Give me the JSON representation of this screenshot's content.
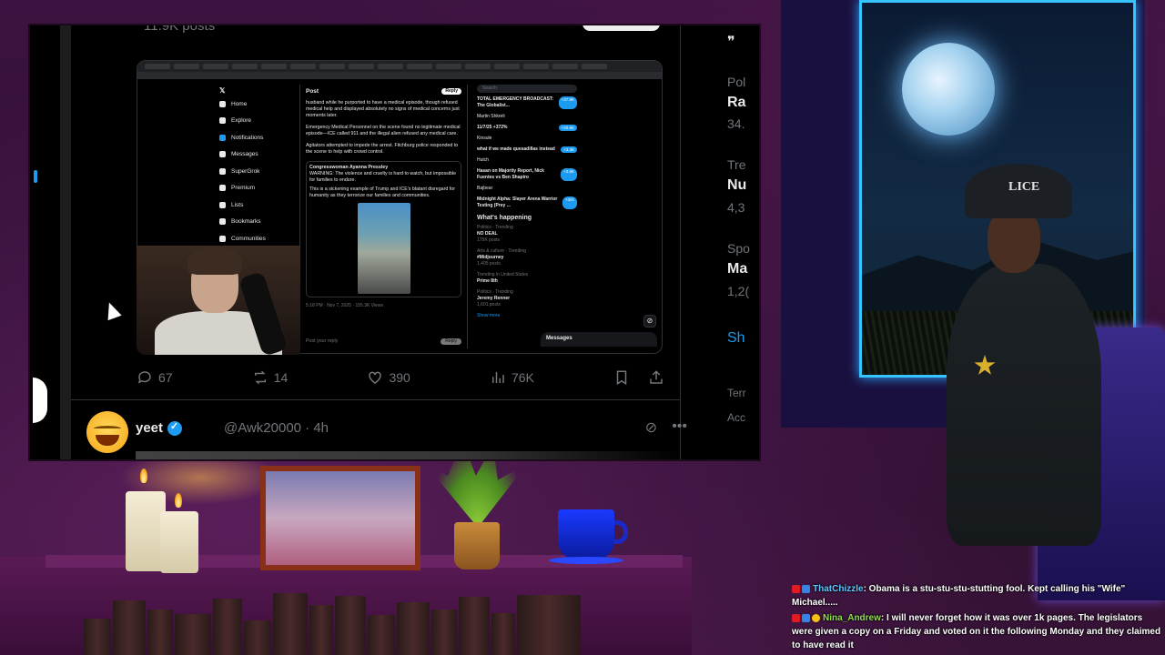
{
  "stream_window": {
    "posts_count": "11.9K posts",
    "tweet_actions": {
      "replies": "67",
      "reposts": "14",
      "likes": "390",
      "views": "76K"
    },
    "next_tweet": {
      "name": "yeet",
      "handle": "@Awk20000 · 4h"
    },
    "right_col": {
      "label1": "Pol",
      "bold1": "Ra",
      "num1": "34.",
      "label2": "Tre",
      "bold2": "Nu",
      "num2": "4,3",
      "label3": "Spo",
      "bold3": "Ma",
      "num3": "1,2(",
      "show_more": "Sh",
      "terms": "Terr",
      "acc": "Acc"
    }
  },
  "nested_screenshot": {
    "nav": [
      "Home",
      "Explore",
      "Notifications",
      "Messages",
      "SuperGrok",
      "Premium",
      "Lists",
      "Bookmarks",
      "Communities"
    ],
    "post_header": "Post",
    "reply_btn": "Reply",
    "paragraphs": [
      "husband while he purported to have a medical episode, though refused medical help and displayed absolutely no signs of medical concerns just moments later.",
      "Emergency Medical Personnel on the scene found no legitimate medical episode—ICE called 911 and the illegal alien refused any medical care.",
      "Agitators attempted to impede the arrest. Fitchburg police responded to the scene to help with crowd control."
    ],
    "quote_author": "Congresswoman Ayanna Pressley",
    "quote_text": "WARNING: The violence and cruelty is hard to watch, but impossible for families to endure.",
    "quote_text2": "This is a sickening example of Trump and ICE's blatant disregard for humanity as they terrorize our families and communities.",
    "meta": "5:18 PM · Nov 7, 2025 · 155.3K Views",
    "reply_placeholder": "Post your reply",
    "reply_send": "Reply",
    "search_placeholder": "Search",
    "side_items": [
      {
        "title": "TOTAL EMERGENCY BROADCAST: The Globalist...",
        "badge": "+37.9K"
      },
      {
        "title": "Martin Shkreli",
        "badge": ""
      },
      {
        "title": "11/7/25 +372%",
        "badge": "+20.9K"
      },
      {
        "title": "Kinsule",
        "badge": ""
      },
      {
        "title": "what if we made quesadillas instead",
        "badge": "+3.3K"
      },
      {
        "title": "Hutch",
        "badge": ""
      },
      {
        "title": "Hasan on Majority Report, Nick Fuentes vs Ben Shapiro",
        "badge": "+3.6K"
      },
      {
        "title": "Bajbear",
        "badge": ""
      },
      {
        "title": "Midnight Alpha: Slayer Arena Warrior Testing (Prey ...",
        "badge": "+301"
      }
    ],
    "happening_title": "What's happening",
    "trends": [
      {
        "ctx": "Politics · Trending",
        "title": "NO DEAL",
        "sub": "175K posts"
      },
      {
        "ctx": "Arts & culture · Trending",
        "title": "#Midjourney",
        "sub": "1,405 posts"
      },
      {
        "ctx": "Trending in United States",
        "title": "Prime 8th",
        "sub": ""
      },
      {
        "ctx": "Politics · Trending",
        "title": "Jeremy Renner",
        "sub": "1,601 posts"
      }
    ],
    "show_more": "Show more",
    "messages": "Messages"
  },
  "room": {
    "cap_text": "LICE"
  },
  "chat": [
    {
      "user": "ThatChizzle",
      "text": ": Obama is a stu-stu-stu-stutting fool. Kept calling his \"Wife\" Michael....."
    },
    {
      "user": "Nina_Andrew",
      "text": ": I will never forget how it was over 1k pages. The legislators were given a copy on a Friday and voted on it the following Monday and they claimed to have read it"
    }
  ],
  "colors": {
    "twitter_blue": "#1d9bf0",
    "muted": "#71767b",
    "window_glow": "#35c4ff"
  }
}
